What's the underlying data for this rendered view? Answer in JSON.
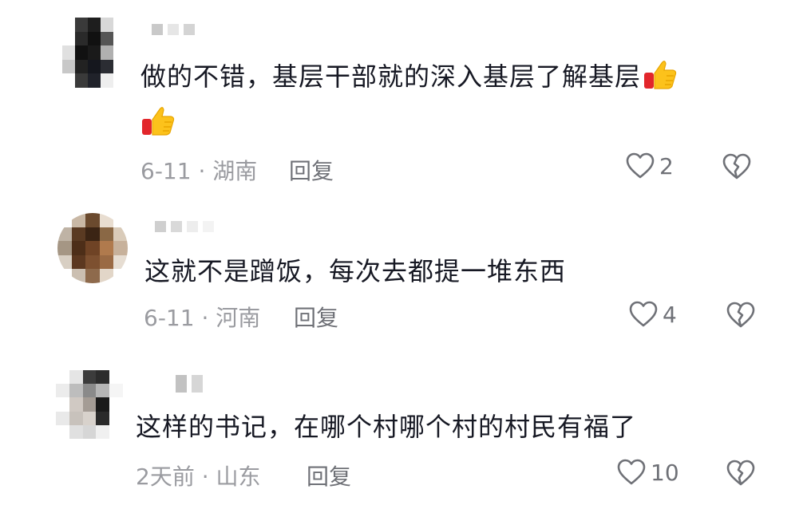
{
  "comments": [
    {
      "text": "做的不错，基层干部就的深入基层了解基层",
      "date_location": "6-11 · 湖南",
      "reply_label": "回复",
      "like_count": "2",
      "emoji": "thumbs-up-icon"
    },
    {
      "text": "这就不是蹭饭，每次去都提一堆东西",
      "date_location": "6-11 · 河南",
      "reply_label": "回复",
      "like_count": "4"
    },
    {
      "text": "这样的书记，在哪个村哪个村的村民有福了",
      "date_location": "2天前 · 山东",
      "reply_label": "回复",
      "like_count": "10"
    }
  ],
  "icons": {
    "like": "heart-outline-icon",
    "dislike": "broken-heart-icon"
  },
  "colors": {
    "text": "#161823",
    "meta": "#9a9ba0",
    "action": "#6f7177"
  }
}
